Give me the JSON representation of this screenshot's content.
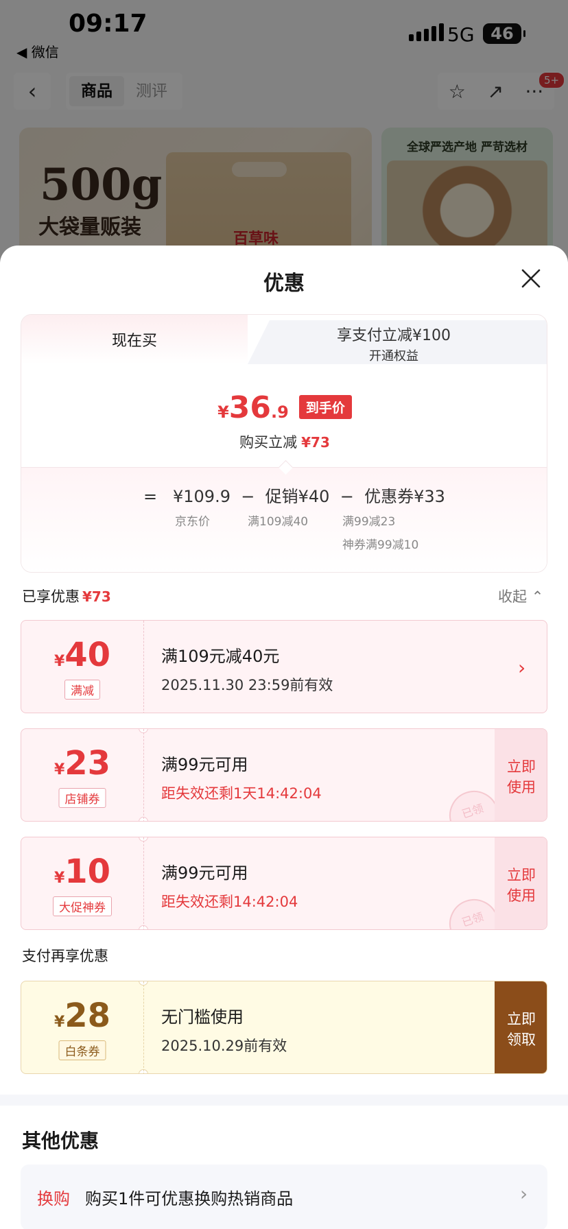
{
  "status": {
    "time": "09:17",
    "back_app": "◀ 微信",
    "network": "5G",
    "battery": "46"
  },
  "nav": {
    "tabs": [
      "商品",
      "测评"
    ],
    "badge": "5+"
  },
  "banner": {
    "weight": "500g",
    "tagline": "大袋量贩装",
    "brand": "百草味",
    "side_title": "全球严选产地 严苛选材"
  },
  "sheet": {
    "title": "优惠",
    "tabs": {
      "now": "现在买",
      "pay_line1": "享支付立减¥100",
      "pay_line2": "开通权益"
    },
    "price": {
      "symbol": "¥",
      "integer": "36",
      "decimal": ".9",
      "badge": "到手价"
    },
    "reduce": {
      "label": "购买立减",
      "amount": "¥73"
    },
    "breakdown": {
      "equals": "=",
      "base": "¥109.9",
      "base_label": "京东价",
      "minus1": "−",
      "promo": "促销¥40",
      "promo_label": "满109减40",
      "minus2": "−",
      "coupon": "优惠券¥33",
      "coupon_label1": "满99减23",
      "coupon_label2": "神券满99减10"
    },
    "applied": {
      "label": "已享优惠",
      "amount": "¥73",
      "collapse": "收起"
    },
    "coupons": [
      {
        "symbol": "¥",
        "amount": "40",
        "tag": "满减",
        "line1": "满109元减40元",
        "line2": "2025.11.30 23:59前有效"
      },
      {
        "symbol": "¥",
        "amount": "23",
        "tag": "店铺券",
        "line1": "满99元可用",
        "line2": "距失效还剩1天14:42:04",
        "button": "立即使用",
        "stamp": "已领"
      },
      {
        "symbol": "¥",
        "amount": "10",
        "tag": "大促神券",
        "line1": "满99元可用",
        "line2": "距失效还剩14:42:04",
        "button": "立即使用",
        "stamp": "已领"
      }
    ],
    "pay_section": {
      "label": "支付再享优惠",
      "coupon": {
        "symbol": "¥",
        "amount": "28",
        "tag": "白条券",
        "line1": "无门槛使用",
        "line2": "2025.10.29前有效",
        "button": "立即领取"
      }
    },
    "other": {
      "title": "其他优惠",
      "row_label": "换购",
      "row_desc": "购买1件可优惠换购热销商品"
    }
  },
  "colors": {
    "accent": "#e4393c",
    "gold": "#8b4d1a",
    "coupon_bg": "#fff3f5",
    "pay_coupon_bg": "#fffbe4"
  }
}
